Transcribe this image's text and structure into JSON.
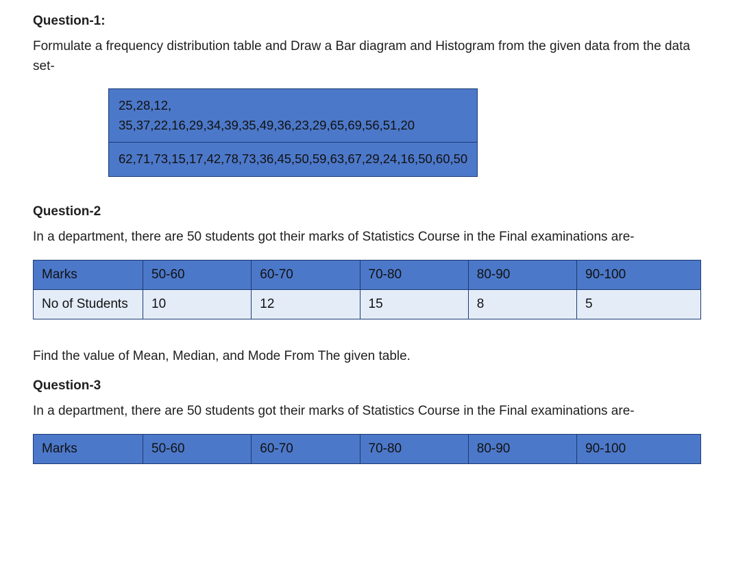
{
  "q1": {
    "heading": "Question-1:",
    "prompt": "Formulate a frequency distribution table and Draw a Bar diagram and Histogram from the given data from the data set-",
    "data_row1": "25,28,12,\n35,37,22,16,29,34,39,35,49,36,23,29,65,69,56,51,20",
    "data_row2": "62,71,73,15,17,42,78,73,36,45,50,59,63,67,29,24,16,50,60,50"
  },
  "q2": {
    "heading": "Question-2",
    "prompt": "In a department, there are 50 students got their marks of Statistics Course in the Final examinations are-",
    "table": {
      "row1_label": "Marks",
      "row1": [
        "50-60",
        "60-70",
        "70-80",
        "80-90",
        "90-100"
      ],
      "row2_label": "No of Students",
      "row2": [
        "10",
        "12",
        "15",
        "8",
        "5"
      ]
    },
    "followup": "Find the value of Mean, Median, and Mode From The given table."
  },
  "q3": {
    "heading": "Question-3",
    "prompt": "In a department, there are 50 students got their marks of Statistics Course in the Final examinations are-",
    "table": {
      "row1_label": "Marks",
      "row1": [
        "50-60",
        "60-70",
        "70-80",
        "80-90",
        "90-100"
      ]
    }
  }
}
